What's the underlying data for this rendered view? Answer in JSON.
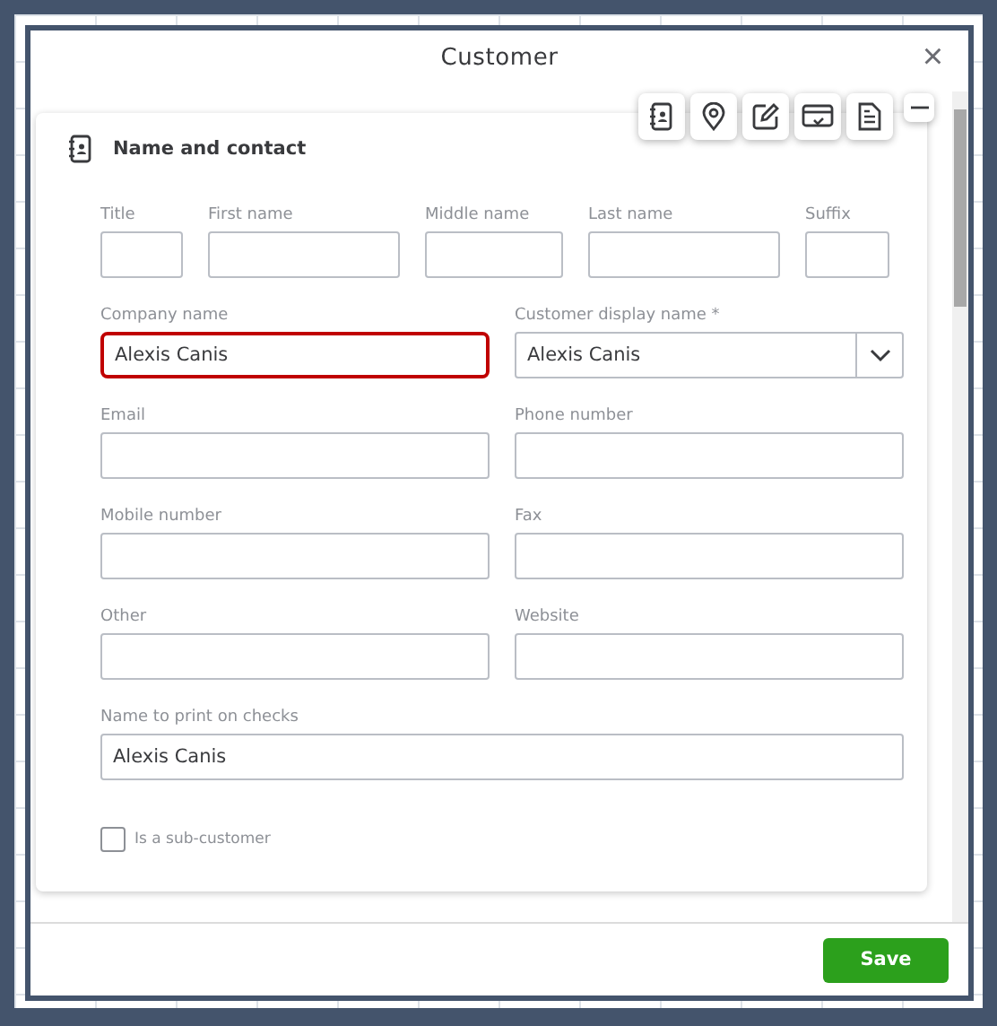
{
  "window": {
    "title": "Customer",
    "close": "×"
  },
  "toolbar": [
    {
      "kind": "contact"
    },
    {
      "kind": "location"
    },
    {
      "kind": "edit"
    },
    {
      "kind": "payment"
    },
    {
      "kind": "document"
    }
  ],
  "section": {
    "title": "Name and contact"
  },
  "rows": [
    [
      {
        "label": "Title",
        "kind": "text",
        "focused": false
      },
      {
        "label": "First name",
        "kind": "text",
        "focused": false
      },
      {
        "label": "Middle name",
        "kind": "text",
        "focused": false
      },
      {
        "label": "Last name",
        "kind": "text",
        "focused": false
      },
      {
        "label": "Suffix",
        "kind": "text",
        "focused": false
      }
    ],
    [
      {
        "label": "Company name",
        "kind": "text",
        "value": "Alexis Canis",
        "focused": true
      },
      {
        "label": "Customer display name *",
        "kind": "select",
        "value": "Alexis Canis",
        "focused": false
      }
    ],
    [
      {
        "label": "Email",
        "kind": "text",
        "focused": false
      },
      {
        "label": "Phone number",
        "kind": "text",
        "focused": false
      }
    ],
    [
      {
        "label": "Mobile number",
        "kind": "text",
        "focused": false
      },
      {
        "label": "Fax",
        "kind": "text",
        "focused": false
      }
    ],
    [
      {
        "label": "Other",
        "kind": "text",
        "focused": false
      },
      {
        "label": "Website",
        "kind": "text",
        "focused": false
      }
    ],
    [
      {
        "label": "Name to print on checks",
        "kind": "text",
        "value": "Alexis Canis",
        "focused": false
      }
    ]
  ],
  "sub_customer": {
    "label": "Is a sub-customer",
    "checked": false
  },
  "buttons": {
    "save": "Save"
  }
}
